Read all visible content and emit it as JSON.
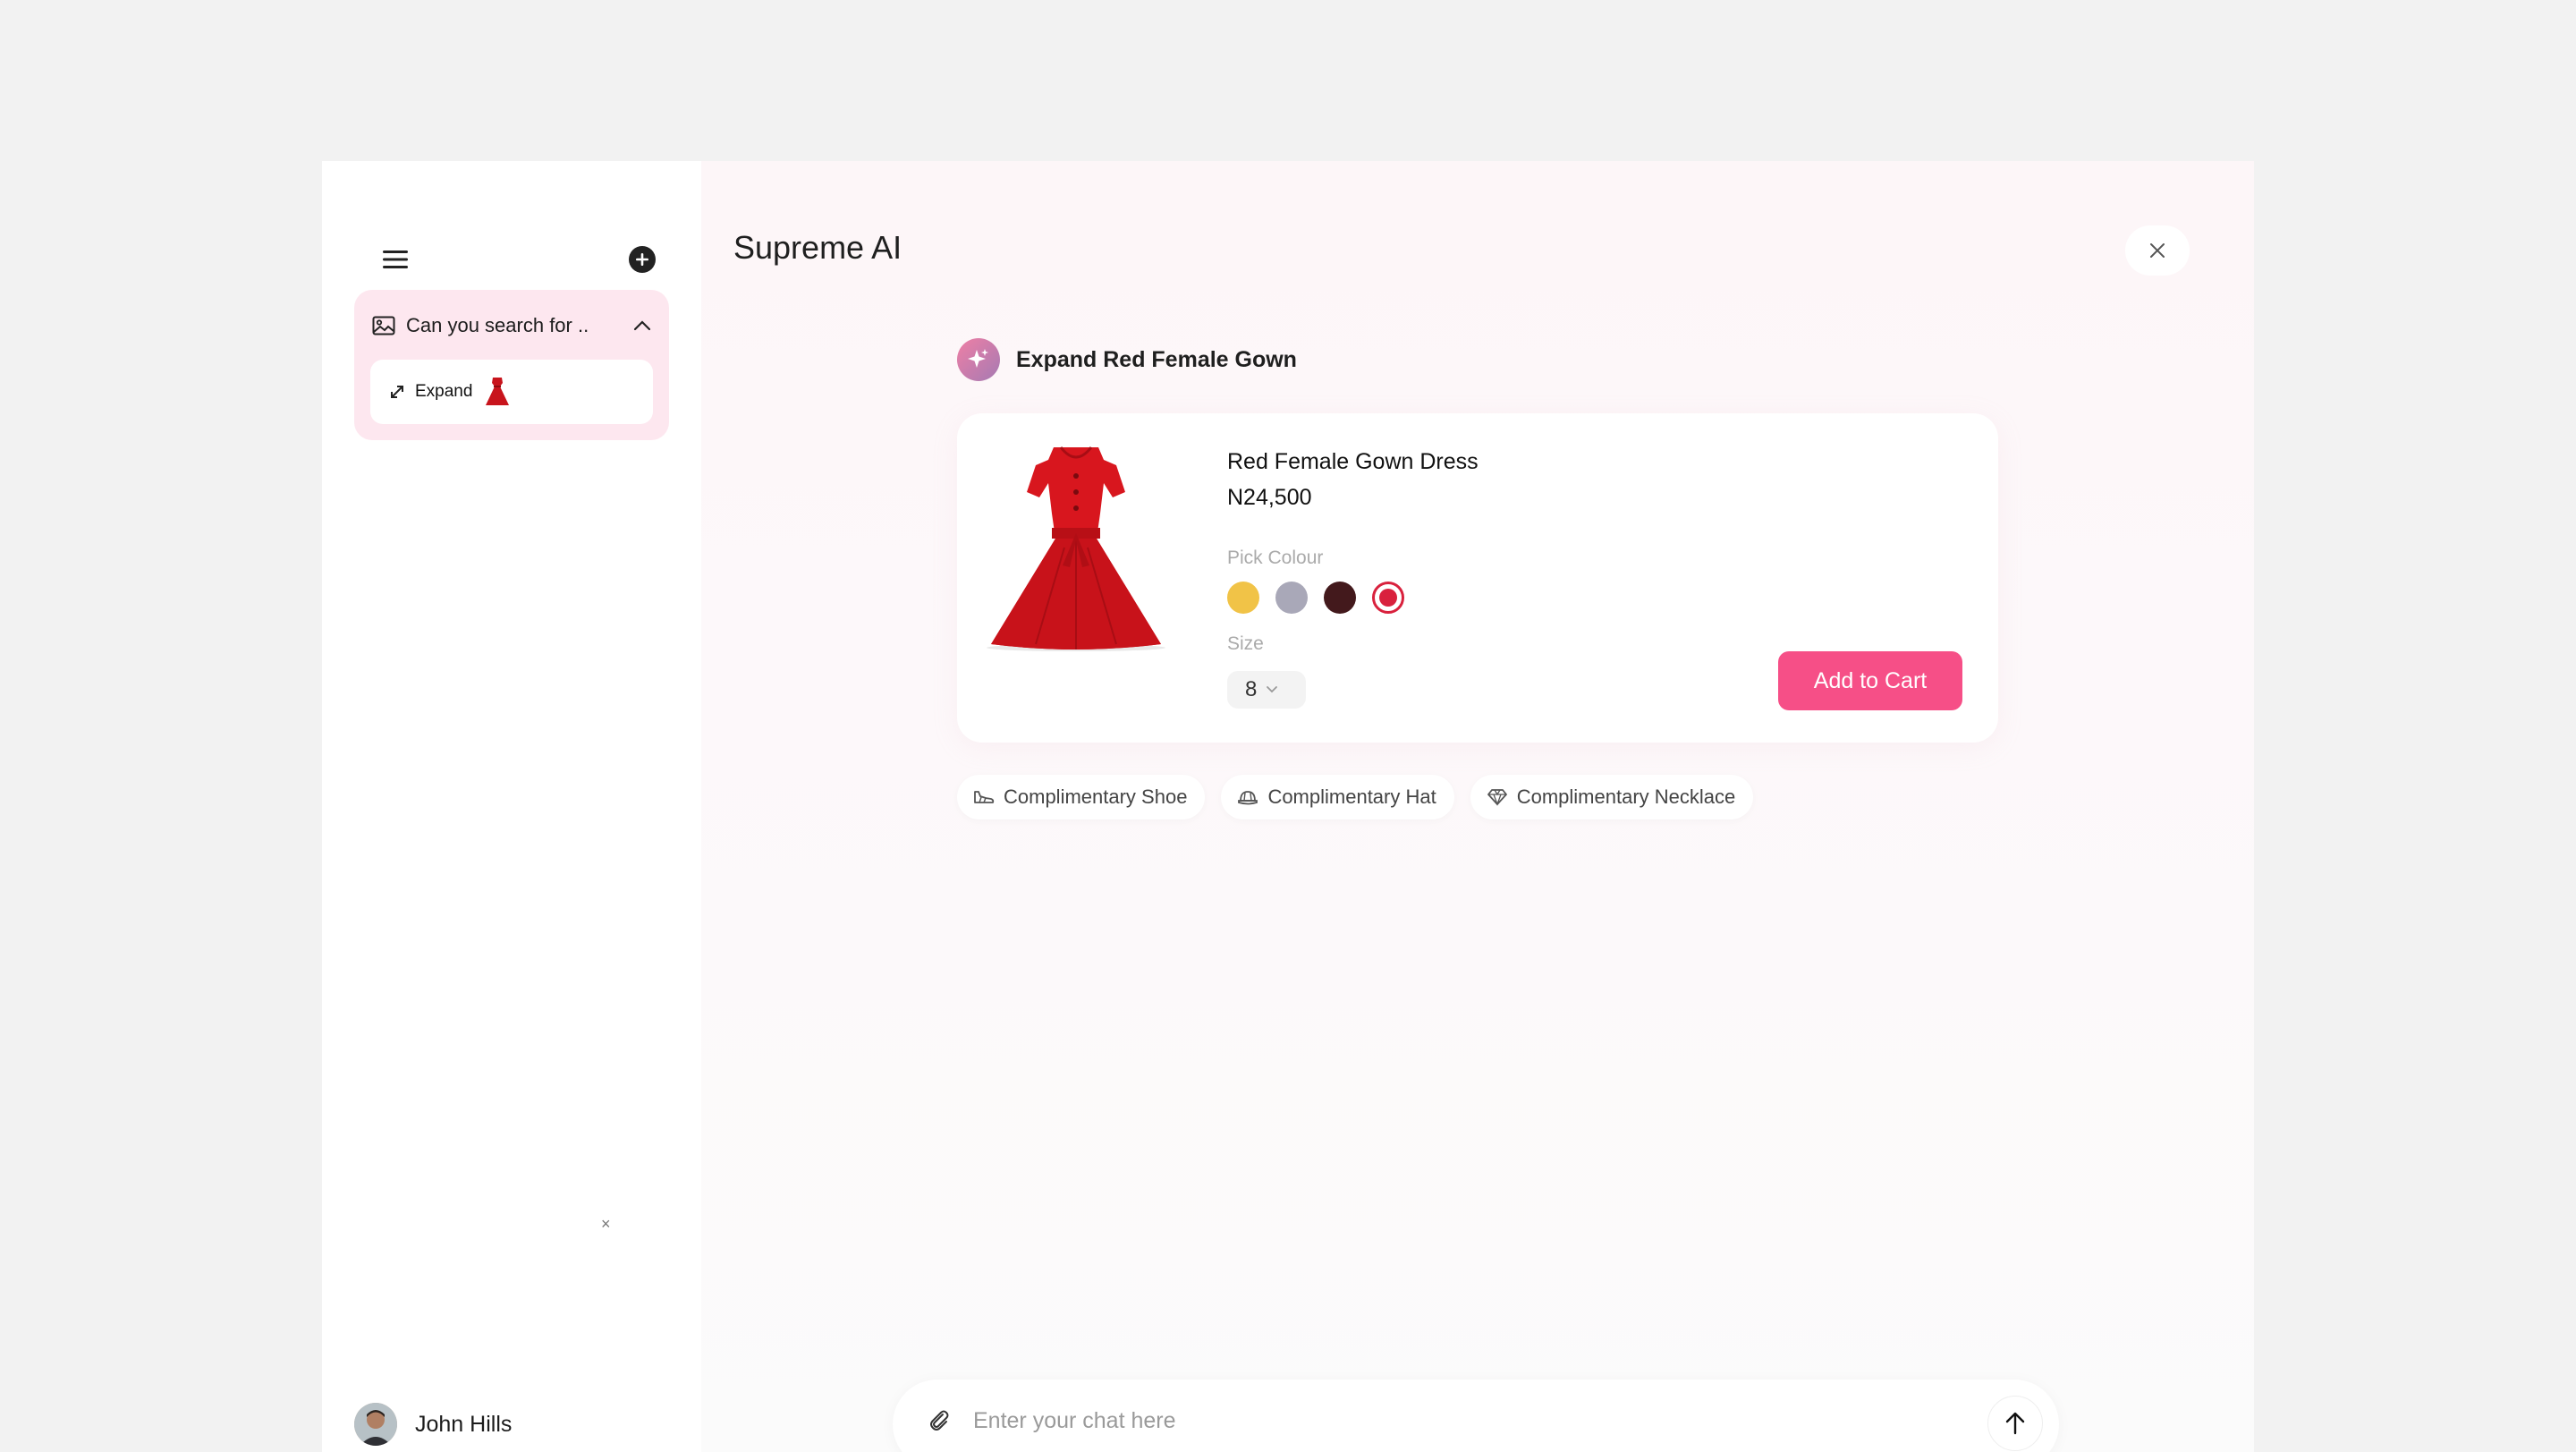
{
  "sidebar": {
    "history": {
      "title": "Can you search for ..",
      "items": [
        {
          "label": "Expand"
        }
      ]
    },
    "mini_close": "×",
    "user": {
      "name": "John Hills"
    }
  },
  "main": {
    "title": "Supreme AI",
    "ai_message": "Expand Red Female Gown",
    "product": {
      "name": "Red Female Gown Dress",
      "price": "N24,500",
      "pick_colour_label": "Pick Colour",
      "colours": [
        "#f1c347",
        "#a9a8b8",
        "#43191c",
        "#d9213d"
      ],
      "selected_colour_index": 3,
      "size_label": "Size",
      "size_value": "8",
      "add_to_cart": "Add to Cart"
    },
    "suggestions": [
      {
        "label": "Complimentary Shoe",
        "icon": "shoe-icon"
      },
      {
        "label": "Complimentary Hat",
        "icon": "hat-icon"
      },
      {
        "label": "Complimentary Necklace",
        "icon": "diamond-icon"
      }
    ],
    "composer": {
      "placeholder": "Enter your chat here"
    }
  },
  "colors": {
    "accent": "#f64f87",
    "history_bg": "#fde7ef"
  }
}
